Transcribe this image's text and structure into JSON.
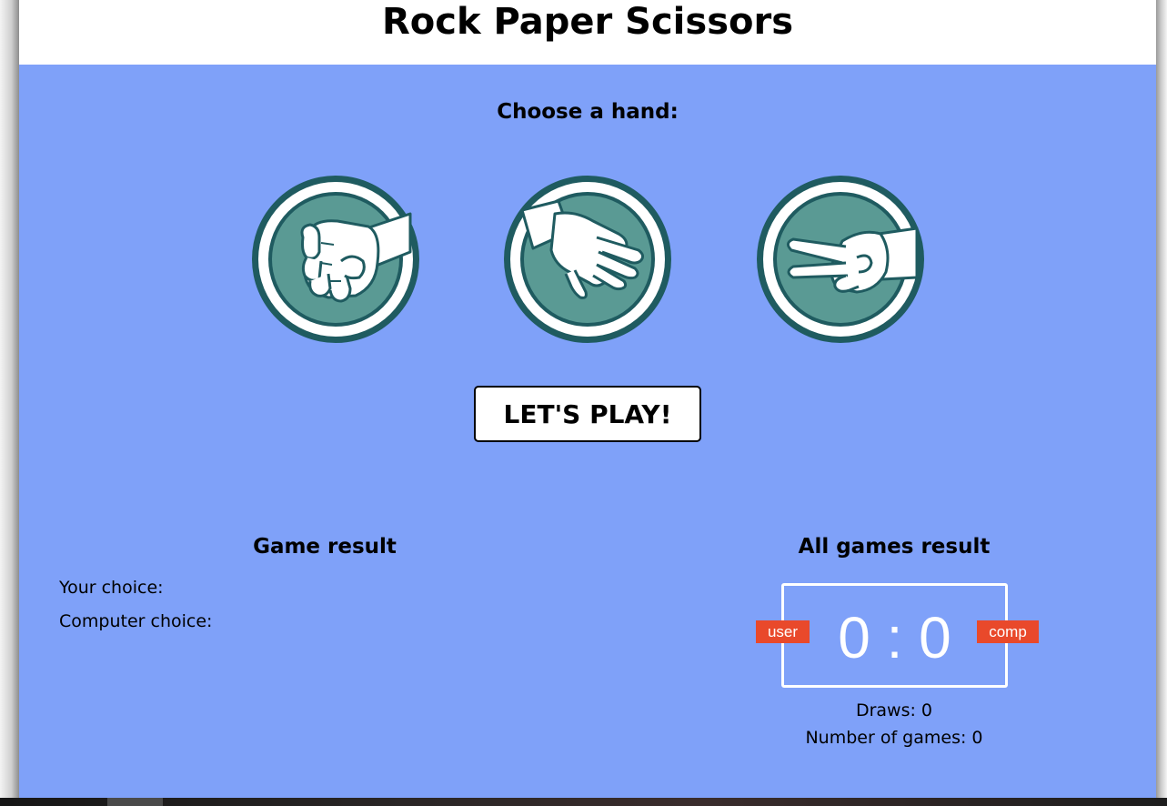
{
  "header": {
    "title": "Rock Paper Scissors"
  },
  "chooser": {
    "title": "Choose a hand:",
    "hands": [
      {
        "name": "rock",
        "icon": "rock-fist-icon"
      },
      {
        "name": "paper",
        "icon": "paper-hand-icon"
      },
      {
        "name": "scissors",
        "icon": "scissors-hand-icon"
      }
    ]
  },
  "play_button": {
    "label": "LET'S PLAY!"
  },
  "game_result": {
    "title": "Game result",
    "your_choice_label": "Your choice:",
    "computer_choice_label": "Computer choice:"
  },
  "all_games": {
    "title": "All games result",
    "user_badge": "user",
    "comp_badge": "comp",
    "score": "0 : 0",
    "draws": "Draws: 0",
    "games": "Number of games: 0"
  },
  "colors": {
    "background": "#7fa1f9",
    "icon_circle": "#5a9a94",
    "icon_ring": "#1f5b60",
    "badge": "#e9492b"
  }
}
